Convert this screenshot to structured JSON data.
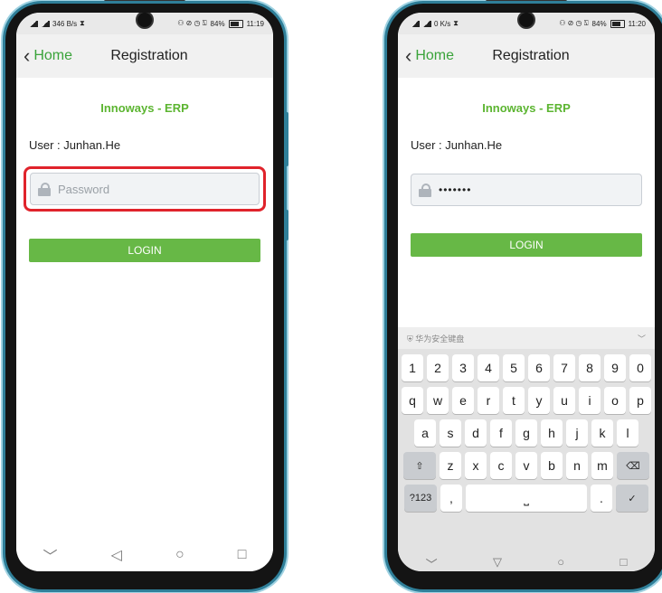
{
  "left_screen": {
    "status": {
      "left_text": "346 B/s",
      "right_text": "84%",
      "time": "11:19"
    },
    "nav": {
      "back_label": "Home",
      "title": "Registration"
    },
    "brand": "Innoways - ERP",
    "user_line": "User : Junhan.He",
    "password": {
      "placeholder": "Password",
      "highlighted": true
    },
    "login_label": "LOGIN",
    "sysnav": [
      "﹀",
      "◁",
      "○",
      "□"
    ]
  },
  "right_screen": {
    "status": {
      "left_text": "0 K/s",
      "right_text": "84%",
      "time": "11:20"
    },
    "nav": {
      "back_label": "Home",
      "title": "Registration"
    },
    "brand": "Innoways - ERP",
    "user_line": "User : Junhan.He",
    "password": {
      "value_masked": "•••••••"
    },
    "login_label": "LOGIN",
    "keyboard": {
      "header_label": "华为安全键盘",
      "row1": [
        "1",
        "2",
        "3",
        "4",
        "5",
        "6",
        "7",
        "8",
        "9",
        "0"
      ],
      "row2": [
        "q",
        "w",
        "e",
        "r",
        "t",
        "y",
        "u",
        "i",
        "o",
        "p"
      ],
      "row3": [
        "a",
        "s",
        "d",
        "f",
        "g",
        "h",
        "j",
        "k",
        "l"
      ],
      "row4": [
        "z",
        "x",
        "c",
        "v",
        "b",
        "n",
        "m"
      ],
      "shift_label": "⇧",
      "backspace_label": "⌫",
      "numbers_label": "?123",
      "comma_label": ",",
      "space_label": "⎵",
      "period_label": ".",
      "enter_label": "✓",
      "collapse_label": "﹀"
    },
    "sysnav": [
      "﹀",
      "▽",
      "○",
      "□"
    ]
  },
  "colors": {
    "accent_green": "#67b846",
    "brand_green": "#5cb531",
    "highlight_red": "#e0232b",
    "bezel_blue": "#2f7f99"
  }
}
